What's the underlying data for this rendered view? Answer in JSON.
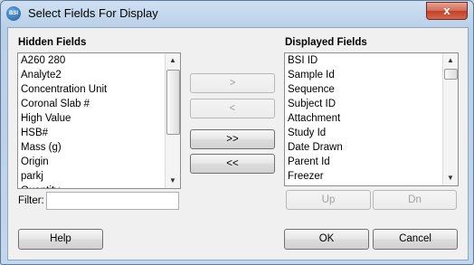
{
  "window": {
    "icon_text": "BSI",
    "title": "Select Fields For Display",
    "close_label": "x"
  },
  "hidden": {
    "label": "Hidden Fields",
    "items": [
      "A260 280",
      "Analyte2",
      "Concentration Unit",
      "Coronal Slab #",
      "High Value",
      "HSB#",
      "Mass (g)",
      "Origin",
      "parkj",
      "Quantity"
    ]
  },
  "displayed": {
    "label": "Displayed Fields",
    "items": [
      "BSI ID",
      "Sample Id",
      "Sequence",
      "Subject ID",
      "Attachment",
      "Study Id",
      "Date Drawn",
      "Parent Id",
      "Freezer"
    ]
  },
  "move_buttons": {
    "add": ">",
    "remove": "<",
    "add_all": ">>",
    "remove_all": "<<"
  },
  "order_buttons": {
    "up": "Up",
    "down": "Dn"
  },
  "filter": {
    "label": "Filter:",
    "value": ""
  },
  "footer": {
    "help": "Help",
    "ok": "OK",
    "cancel": "Cancel"
  },
  "scroll_icons": {
    "up": "scroll-up-arrow",
    "down": "scroll-down-arrow"
  }
}
